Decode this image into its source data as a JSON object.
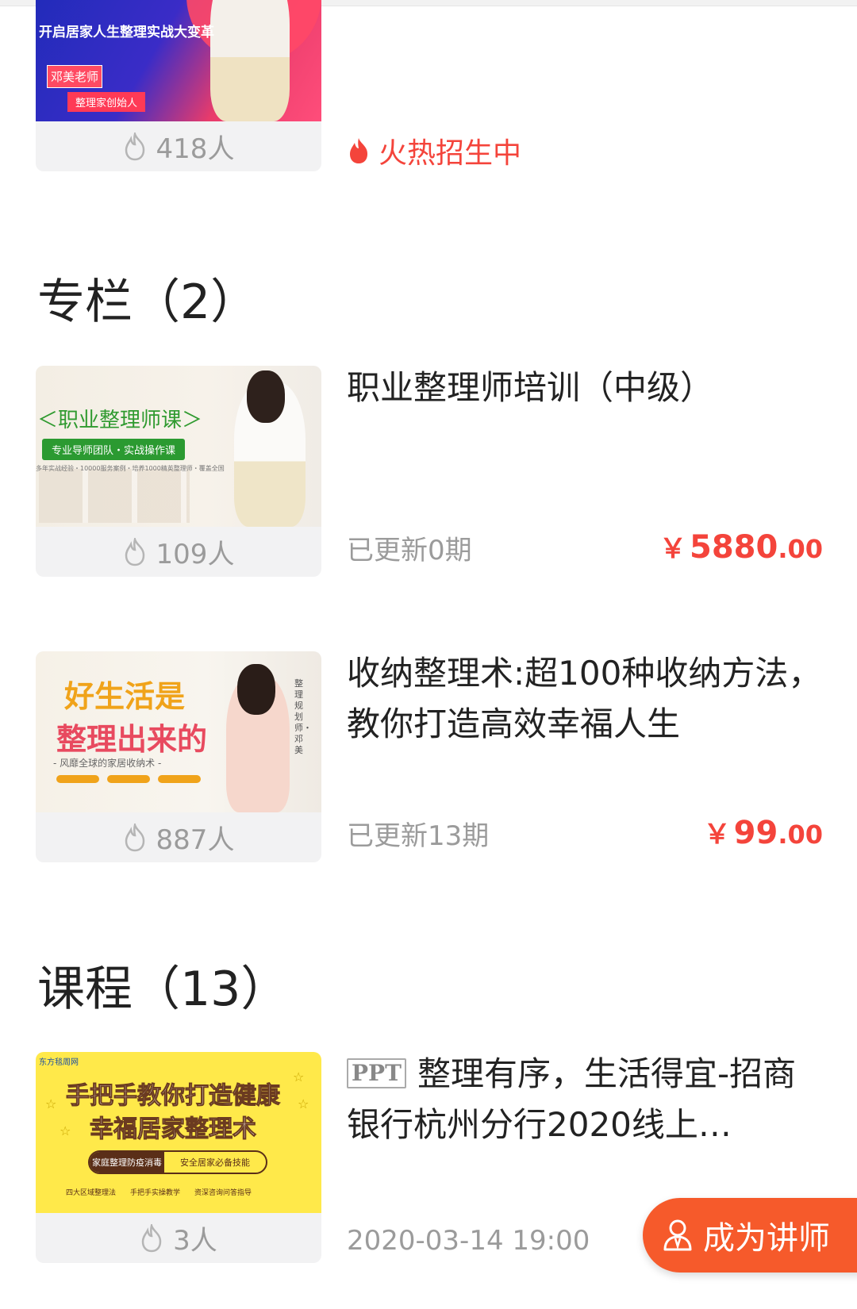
{
  "top_card": {
    "thumb": {
      "subtitle": "开启居家人生整理实战大变革",
      "badge_name": "邓美老师",
      "badge_role": "整理家创始人"
    },
    "count": "418人",
    "status": "火热招生中"
  },
  "columns_section": {
    "title": "专栏（2）",
    "items": [
      {
        "title": "职业整理师培训（中级）",
        "thumb": {
          "title": "＜职业整理师课＞",
          "pill": "专业导师团队・实战操作课",
          "small": "多年实战经验・10000服务案例・培养1000精英整理师・覆盖全国"
        },
        "count": "109人",
        "updated": "已更新0期",
        "price": {
          "currency": "￥",
          "integer": "5880",
          "decimal": ".00"
        }
      },
      {
        "title": "收纳整理术:超100种收纳方法，教你打造高效幸福人生",
        "thumb": {
          "line1": "好生活是",
          "line2": "整理出来的",
          "line3": "- 风靡全球的家居收纳术 -",
          "vertical": "整理规划师・邓美"
        },
        "count": "887人",
        "updated": "已更新13期",
        "price": {
          "currency": "￥",
          "integer": "99",
          "decimal": ".00"
        }
      }
    ]
  },
  "courses_section": {
    "title": "课程（13）",
    "items": [
      {
        "tag": "PPT",
        "title": "整理有序，生活得宜-招商银行杭州分行2020线上…",
        "thumb": {
          "brand": "东方毯周网",
          "line1": "手把手教你打造健康",
          "line2": "幸福居家整理术",
          "bar_a": "家庭整理防疫消毒",
          "bar_b": "安全居家必备技能",
          "checks": [
            "四大区域整理法",
            "手把手实操教学",
            "资深咨询问答指导"
          ]
        },
        "count": "3人",
        "datetime": "2020-03-14 19:00"
      }
    ]
  },
  "float_button": {
    "label": "成为讲师"
  },
  "colors": {
    "accent": "#f4443b",
    "float_bg": "#f65a2b",
    "muted": "#9b9b9b"
  }
}
